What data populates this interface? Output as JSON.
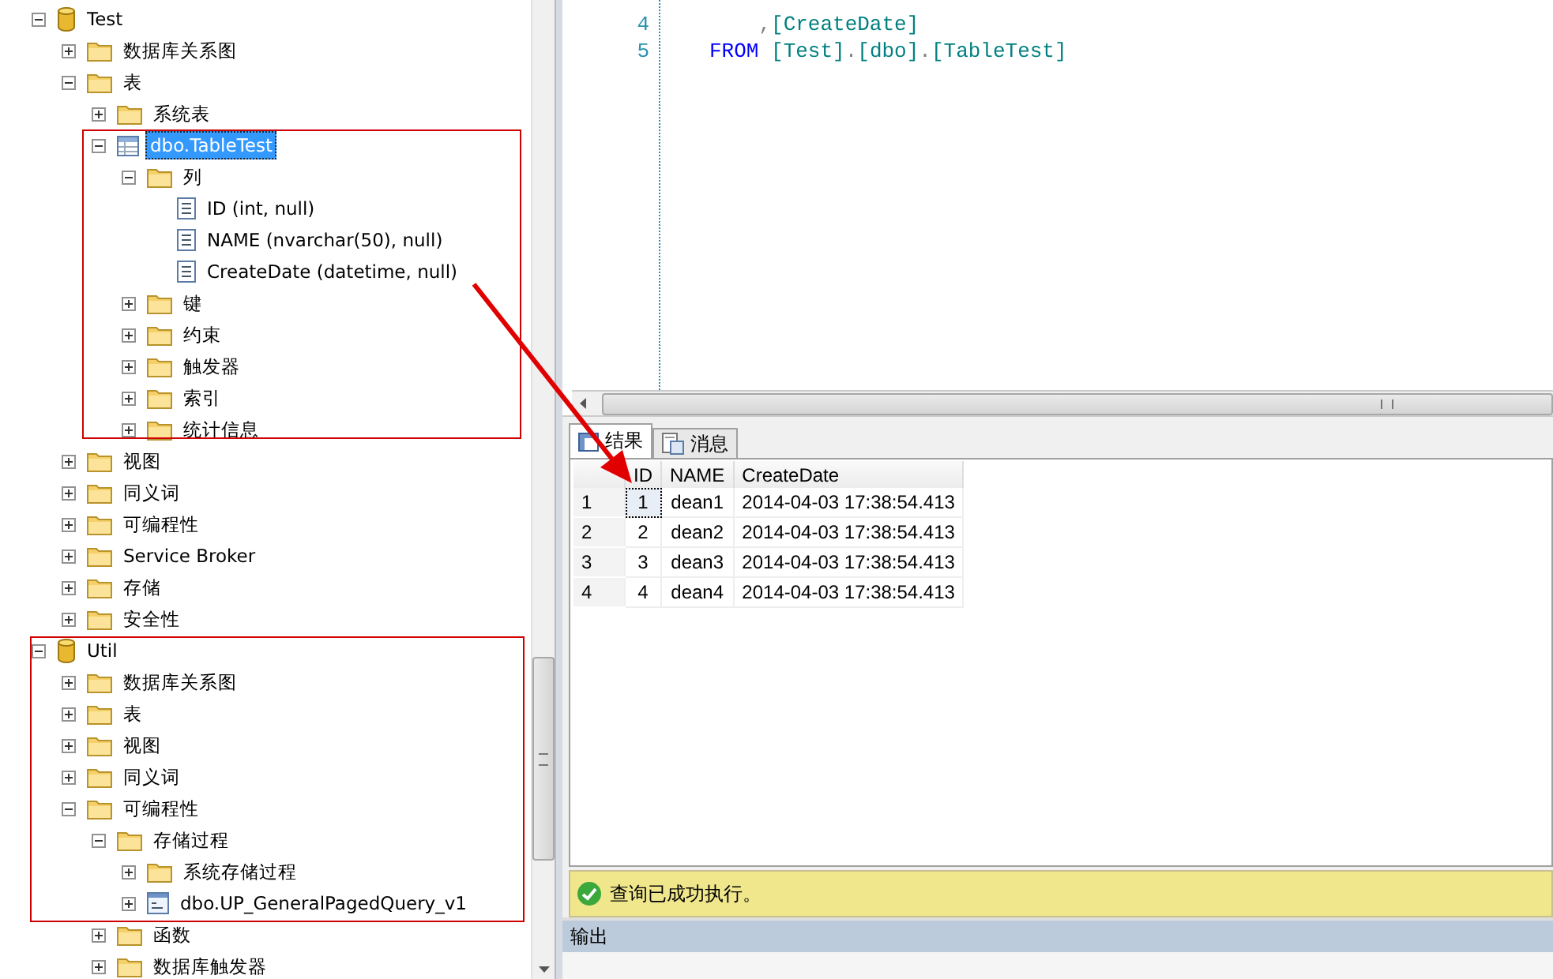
{
  "object_explorer": {
    "nodes": [
      {
        "label": "Test",
        "kind": "database",
        "expanded": true,
        "selected": false,
        "children": [
          {
            "label": "数据库关系图",
            "kind": "folder",
            "expanded": false,
            "selected": false
          },
          {
            "label": "表",
            "kind": "folder",
            "expanded": true,
            "selected": false,
            "children": [
              {
                "label": "系统表",
                "kind": "folder",
                "expanded": false,
                "selected": false
              },
              {
                "label": "dbo.TableTest",
                "kind": "table",
                "expanded": true,
                "selected": true,
                "children": [
                  {
                    "label": "列",
                    "kind": "folder",
                    "expanded": true,
                    "selected": false,
                    "children": [
                      {
                        "label": "ID (int, null)",
                        "kind": "column",
                        "selected": false
                      },
                      {
                        "label": "NAME (nvarchar(50), null)",
                        "kind": "column",
                        "selected": false
                      },
                      {
                        "label": "CreateDate (datetime, null)",
                        "kind": "column",
                        "selected": false
                      }
                    ]
                  },
                  {
                    "label": "键",
                    "kind": "folder",
                    "expanded": false,
                    "selected": false
                  },
                  {
                    "label": "约束",
                    "kind": "folder",
                    "expanded": false,
                    "selected": false
                  },
                  {
                    "label": "触发器",
                    "kind": "folder",
                    "expanded": false,
                    "selected": false
                  },
                  {
                    "label": "索引",
                    "kind": "folder",
                    "expanded": false,
                    "selected": false
                  },
                  {
                    "label": "统计信息",
                    "kind": "folder",
                    "expanded": false,
                    "selected": false
                  }
                ]
              }
            ]
          },
          {
            "label": "视图",
            "kind": "folder",
            "expanded": false,
            "selected": false
          },
          {
            "label": "同义词",
            "kind": "folder",
            "expanded": false,
            "selected": false
          },
          {
            "label": "可编程性",
            "kind": "folder",
            "expanded": false,
            "selected": false
          },
          {
            "label": "Service Broker",
            "kind": "folder",
            "expanded": false,
            "selected": false
          },
          {
            "label": "存储",
            "kind": "folder",
            "expanded": false,
            "selected": false
          },
          {
            "label": "安全性",
            "kind": "folder",
            "expanded": false,
            "selected": false
          }
        ]
      },
      {
        "label": "Util",
        "kind": "database",
        "expanded": true,
        "selected": false,
        "children": [
          {
            "label": "数据库关系图",
            "kind": "folder",
            "expanded": false,
            "selected": false
          },
          {
            "label": "表",
            "kind": "folder",
            "expanded": false,
            "selected": false
          },
          {
            "label": "视图",
            "kind": "folder",
            "expanded": false,
            "selected": false
          },
          {
            "label": "同义词",
            "kind": "folder",
            "expanded": false,
            "selected": false
          },
          {
            "label": "可编程性",
            "kind": "folder",
            "expanded": true,
            "selected": false,
            "children": [
              {
                "label": "存储过程",
                "kind": "folder",
                "expanded": true,
                "selected": false,
                "children": [
                  {
                    "label": "系统存储过程",
                    "kind": "folder",
                    "expanded": false,
                    "selected": false
                  },
                  {
                    "label": "dbo.UP_GeneralPagedQuery_v1",
                    "kind": "procedure",
                    "expanded": false,
                    "selected": false
                  }
                ]
              },
              {
                "label": "函数",
                "kind": "folder",
                "expanded": false,
                "selected": false
              },
              {
                "label": "数据库触发器",
                "kind": "folder",
                "expanded": false,
                "selected": false
              }
            ]
          }
        ]
      }
    ]
  },
  "editor": {
    "lines": [
      {
        "number": "4",
        "tokens": [
          {
            "kind": "punct",
            "text": "    ,"
          },
          {
            "kind": "identifier",
            "text": "[CreateDate]"
          }
        ]
      },
      {
        "number": "5",
        "tokens": [
          {
            "kind": "keyword",
            "text": "FROM"
          },
          {
            "kind": "identifier",
            "text": " [Test]"
          },
          {
            "kind": "punct",
            "text": "."
          },
          {
            "kind": "identifier",
            "text": "[dbo]"
          },
          {
            "kind": "punct",
            "text": "."
          },
          {
            "kind": "identifier",
            "text": "[TableTest]"
          }
        ]
      }
    ]
  },
  "results": {
    "tabs": [
      {
        "label": "结果",
        "kind": "grid",
        "selected": true
      },
      {
        "label": "消息",
        "kind": "messages",
        "selected": false
      }
    ],
    "grid": {
      "columns": [
        "ID",
        "NAME",
        "CreateDate"
      ],
      "rows": [
        {
          "number": "1",
          "cells": [
            {
              "text": "1",
              "selected": true
            },
            {
              "text": "dean1",
              "selected": false
            },
            {
              "text": "2014-04-03 17:38:54.413",
              "selected": false
            }
          ]
        },
        {
          "number": "2",
          "cells": [
            {
              "text": "2",
              "selected": false
            },
            {
              "text": "dean2",
              "selected": false
            },
            {
              "text": "2014-04-03 17:38:54.413",
              "selected": false
            }
          ]
        },
        {
          "number": "3",
          "cells": [
            {
              "text": "3",
              "selected": false
            },
            {
              "text": "dean3",
              "selected": false
            },
            {
              "text": "2014-04-03 17:38:54.413",
              "selected": false
            }
          ]
        },
        {
          "number": "4",
          "cells": [
            {
              "text": "4",
              "selected": false
            },
            {
              "text": "dean4",
              "selected": false
            },
            {
              "text": "2014-04-03 17:38:54.413",
              "selected": false
            }
          ]
        }
      ]
    },
    "status": {
      "kind": "success",
      "message": "查询已成功执行。"
    }
  },
  "output_panel": {
    "title": "输出"
  }
}
